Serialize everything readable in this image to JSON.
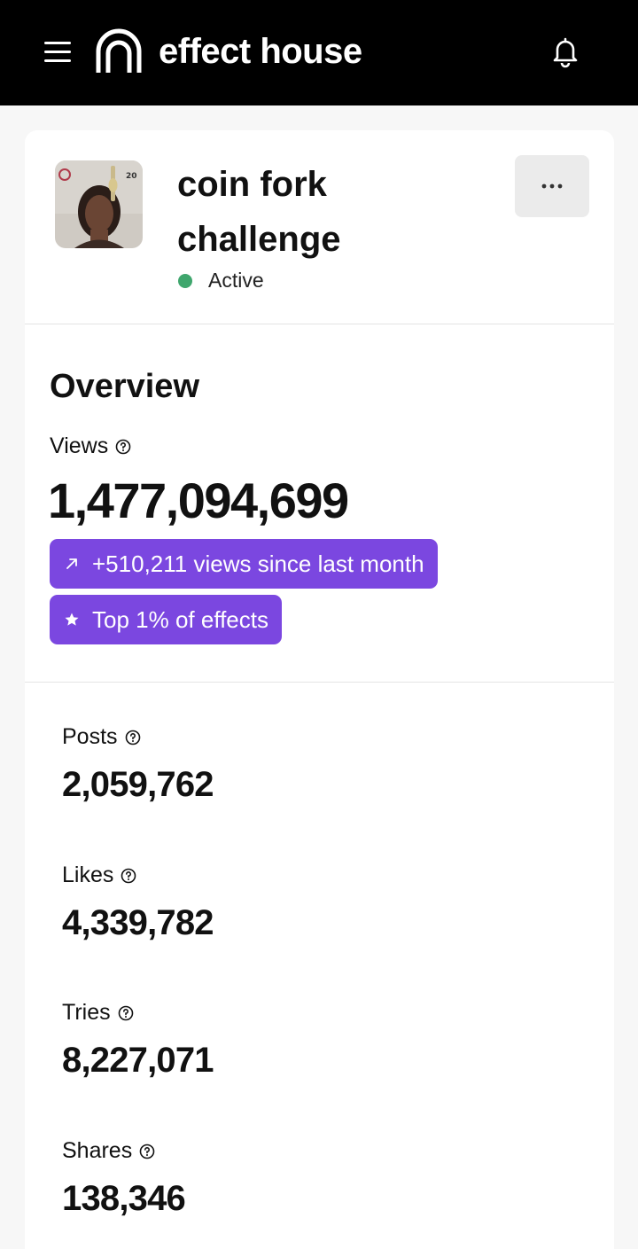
{
  "header": {
    "brand": "effect house",
    "menu_icon": "hamburger-menu-icon",
    "logo_icon": "effect-house-arch-logo-icon",
    "notification_icon": "bell-icon"
  },
  "effect": {
    "title": "coin fork challenge",
    "status": "Active",
    "status_color": "#3fa66d",
    "more_icon": "more-horizontal-icon"
  },
  "overview": {
    "title": "Overview",
    "views_label": "Views",
    "views_value": "1,477,094,699",
    "growth_badge": "+510,211 views since last month",
    "growth_icon": "arrow-up-right-icon",
    "rank_badge": "Top 1% of effects",
    "rank_icon": "star-icon",
    "badge_color": "#7b47e0"
  },
  "stats": [
    {
      "label": "Posts",
      "value": "2,059,762"
    },
    {
      "label": "Likes",
      "value": "4,339,782"
    },
    {
      "label": "Tries",
      "value": "8,227,071"
    },
    {
      "label": "Shares",
      "value": "138,346"
    }
  ]
}
